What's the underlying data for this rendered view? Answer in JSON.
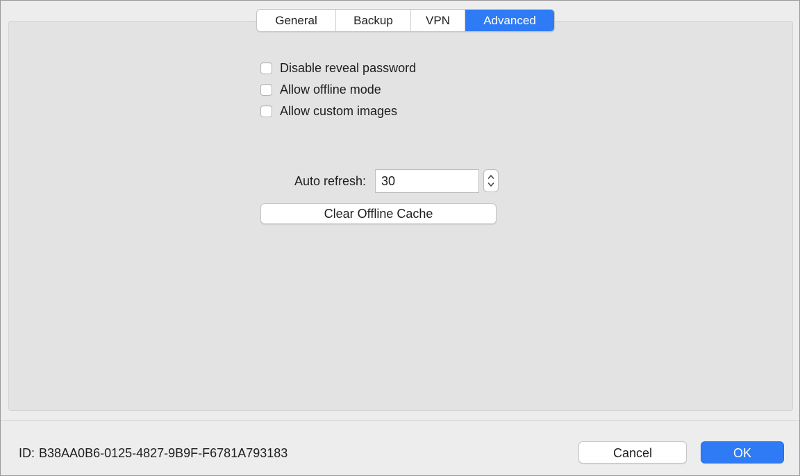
{
  "tabs": [
    {
      "label": "General",
      "active": false
    },
    {
      "label": "Backup",
      "active": false
    },
    {
      "label": "VPN",
      "active": false
    },
    {
      "label": "Advanced",
      "active": true
    }
  ],
  "options": [
    {
      "label": "Disable reveal password",
      "checked": false
    },
    {
      "label": "Allow offline mode",
      "checked": false
    },
    {
      "label": "Allow custom images",
      "checked": false
    }
  ],
  "auto_refresh": {
    "label": "Auto refresh:",
    "value": "30"
  },
  "clear_cache_label": "Clear Offline Cache",
  "footer": {
    "id_label": "ID:",
    "id_value": "B38AA0B6-0125-4827-9B9F-F6781A793183",
    "cancel_label": "Cancel",
    "ok_label": "OK"
  },
  "colors": {
    "accent": "#2f7bf5",
    "window_bg": "#ededed",
    "panel_bg": "#e3e3e3"
  },
  "icons": {
    "stepper": "stepper-arrows-icon"
  }
}
